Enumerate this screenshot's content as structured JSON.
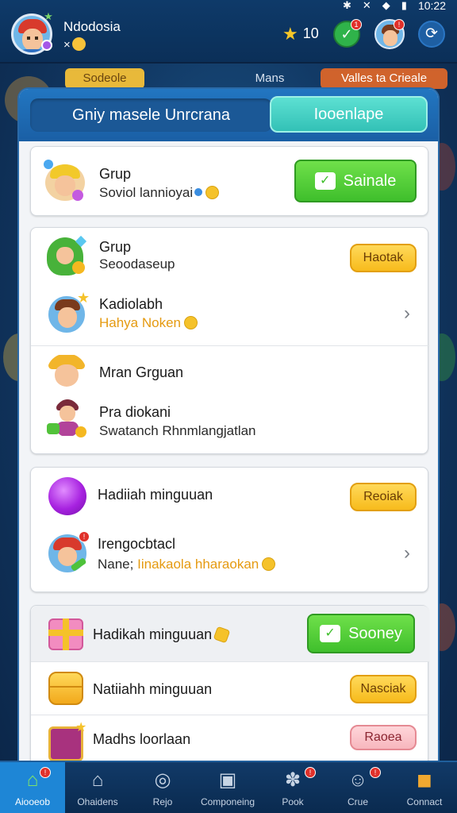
{
  "status": {
    "time": "10:22"
  },
  "header": {
    "user_name": "Ndodosia",
    "user_sub": "×",
    "stars": "10",
    "notif_check": "1",
    "notif_avatar": "!"
  },
  "background_tabs": [
    "Sodeole",
    "Mans",
    "Valles  ta Crieale"
  ],
  "segment": {
    "left": "Gniy masele Unrcrana",
    "right": "Iooenlape"
  },
  "cards": {
    "card1": {
      "title": "Grup",
      "sub": "Soviol lannioyai",
      "button": "Sainale"
    },
    "card2": {
      "rows": [
        {
          "title": "Grup",
          "sub": "Seoodaseup",
          "button": "Haotak"
        },
        {
          "title": "Kadiolabh",
          "sub": "Hahya Noken"
        },
        {
          "title": "Mran Grguan"
        },
        {
          "title": "Pra diokani",
          "sub": "Swatanch Rhnmlangjatlan"
        }
      ]
    },
    "card3": {
      "rows": [
        {
          "title": "Hadiiah minguuan",
          "button": "Reoiak"
        },
        {
          "title": "Irengocbtacl",
          "sub_prefix": "Nane;",
          "sub": "Iinakaola hharaokan"
        }
      ]
    },
    "card4": {
      "rows": [
        {
          "title": "Hadikah minguuan",
          "button": "Sooney"
        },
        {
          "title": "Natiiahh minguuan",
          "button": "Nasciak"
        },
        {
          "title": "Madhs loorlaan",
          "button": "Raoea"
        }
      ]
    }
  },
  "bottom_nav": [
    {
      "label": "Aiooeob",
      "icon": "home-icon"
    },
    {
      "label": "Ohaidens",
      "icon": "house-icon"
    },
    {
      "label": "Rejo",
      "icon": "compass-icon"
    },
    {
      "label": "Componeing",
      "icon": "id-card-icon"
    },
    {
      "label": "Pook",
      "icon": "paw-icon"
    },
    {
      "label": "Crue",
      "icon": "smile-icon"
    },
    {
      "label": "Connact",
      "icon": "chest-icon"
    }
  ]
}
